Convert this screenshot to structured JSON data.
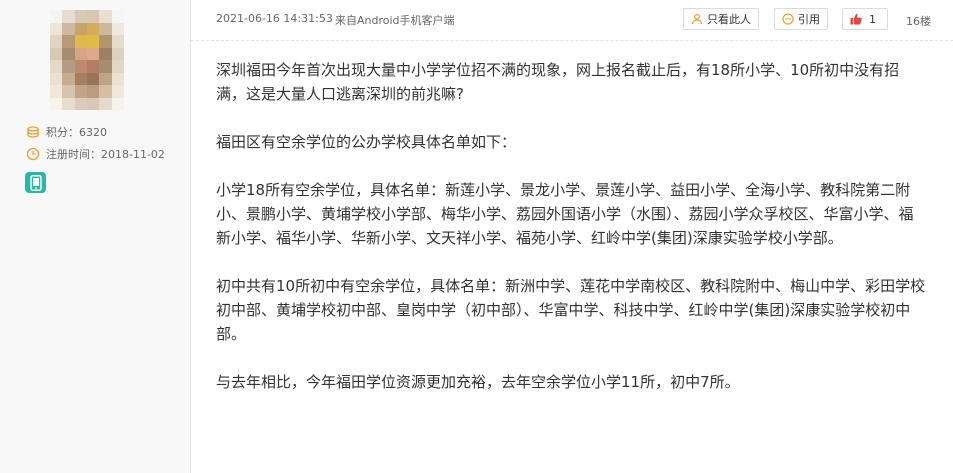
{
  "user": {
    "points_label": "积分：",
    "points_value": "6320",
    "reg_label": "注册时间：",
    "reg_date": "2018-11-02",
    "points_icon": "coins-icon",
    "reg_icon": "clock-icon",
    "device_icon": "mobile-phone-icon"
  },
  "post": {
    "time": "2021-06-16 14:31:53",
    "client": "来自Android手机客户端",
    "only_author_label": "只看此人",
    "quote_label": "引用",
    "like_count": "1",
    "floor": "16楼",
    "paragraphs": [
      "深圳福田今年首次出现大量中小学学位招不满的现象，网上报名截止后，有18所小学、10所初中没有招满，这是大量人口逃离深圳的前兆嘛?",
      "福田区有空余学位的公办学校具体名单如下：",
      "小学18所有空余学位，具体名单：新莲小学、景龙小学、景莲小学、益田小学、全海小学、教科院第二附小、景鹏小学、黄埔学校小学部、梅华小学、荔园外国语小学（水围）、荔园小学众孚校区、华富小学、福新小学、福华小学、华新小学、文天祥小学、福苑小学、红岭中学(集团)深康实验学校小学部。",
      "初中共有10所初中有空余学位，具体名单：新洲中学、莲花中学南校区、教科院附中、梅山中学、彩田学校初中部、黄埔学校初中部、皇岗中学（初中部）、华富中学、科技中学、红岭中学(集团)深康实验学校初中部。",
      "与去年相比，今年福田学位资源更加充裕，去年空余学位小学11所，初中7所。"
    ]
  },
  "colors": {
    "accent_orange": "#f0a030",
    "like_red": "#e8463c",
    "teal": "#28b9a4"
  }
}
